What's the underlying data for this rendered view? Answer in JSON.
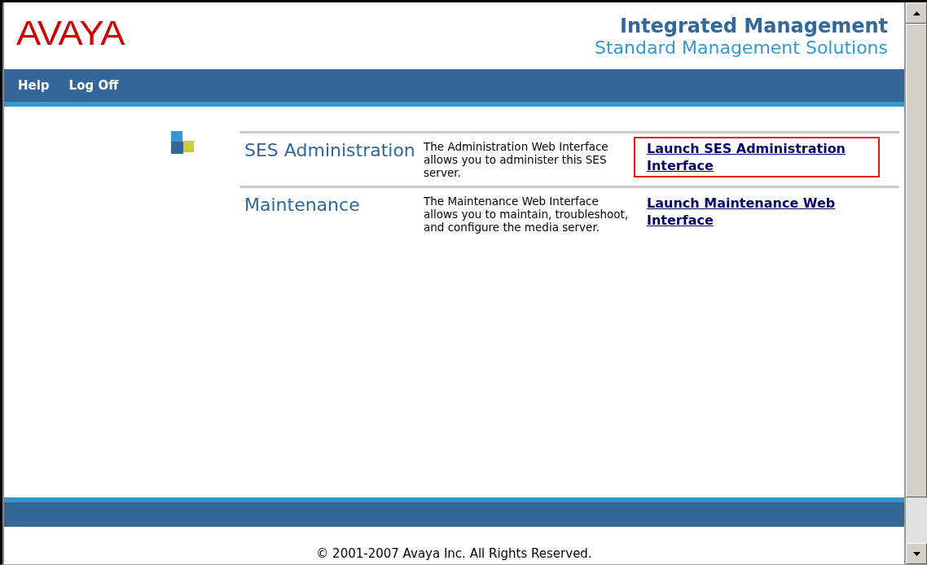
{
  "header": {
    "logo": "AVAYA",
    "title": "Integrated Management",
    "subtitle": "Standard Management Solutions"
  },
  "nav": [
    "Help",
    "Log Off"
  ],
  "items": [
    {
      "title": "SES Administration",
      "description": "The Administration Web Interface allows you to administer this SES server.",
      "link": "Launch SES Administration Interface",
      "highlighted": true
    },
    {
      "title": "Maintenance",
      "description": "The Maintenance Web Interface allows you to maintain, troubleshoot, and configure the media server.",
      "link": "Launch Maintenance Web Interface",
      "highlighted": false
    }
  ],
  "footer": "© 2001-2007 Avaya Inc. All Rights Reserved."
}
